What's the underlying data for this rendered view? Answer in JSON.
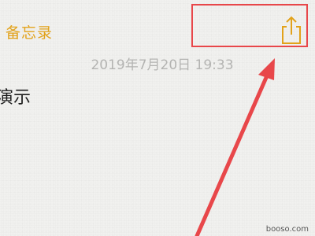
{
  "nav": {
    "back_label": "备忘录",
    "share_icon": "share-icon",
    "accent_color": "#e2a21a"
  },
  "note": {
    "timestamp": "2019年7月20日 19:33",
    "body_text": "演示"
  },
  "annotation": {
    "highlight_color": "#e8474a",
    "arrow_color": "#e8474a"
  },
  "watermark": "booso.com"
}
